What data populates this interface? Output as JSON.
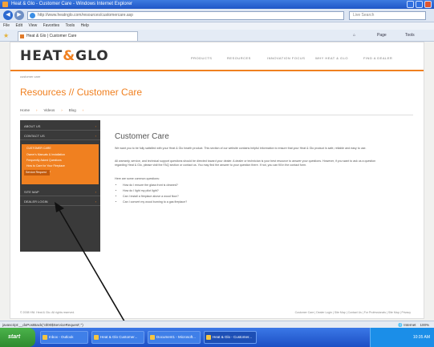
{
  "window": {
    "title": "Heat & Glo - Customer Care - Windows Internet Explorer"
  },
  "browser": {
    "address": "http://www.heatnglo.com/resources/customercare.asp",
    "search_placeholder": "Live Search",
    "menu": [
      "File",
      "Edit",
      "View",
      "Favorites",
      "Tools",
      "Help"
    ],
    "tab_label": "Heat & Glo | Customer Care",
    "commands": [
      "Page",
      "Tools"
    ]
  },
  "site": {
    "logo_left": "HEAT",
    "logo_flame": "&",
    "logo_right": "GLO",
    "topnav": [
      "PRODUCTS",
      "RESOURCES",
      "INNOVATION FOCUS",
      "WHY HEAT & GLO",
      "FIND A DEALER"
    ],
    "breadcrumb": "customer care",
    "page_heading": "Resources // Customer Care",
    "subnav": [
      "Home",
      "Videos",
      "Blog"
    ],
    "sidebar": {
      "items": [
        "ABOUT US",
        "CONTACT US"
      ],
      "active_item": "CUSTOMER CARE",
      "sub_items": [
        "Owner's Manuals & Installation",
        "Frequently Asked Questions",
        "How to Care for Your Fireplace",
        "Replacement Parts",
        "Service Request"
      ],
      "bottom_items": [
        "SITE MAP",
        "DEALER LOGIN"
      ]
    },
    "content": {
      "title": "Customer Care",
      "para1": "We want you to be fully satisfied with your Heat & Glo hearth product. This section of our website contains helpful information to ensure that your Heat & Glo product is safe, reliable and easy to use.",
      "para2": "All warranty, service, and technical support questions should be directed toward your dealer. A dealer or technician is your best resource to answer your questions. However, if you want to ask us a question regarding Heat & Glo, please visit the FAQ section or contact us. You may find the answer to your question there. If not, you can fill in the contact form.",
      "para3": "Here are some common questions:",
      "bullets": [
        "How do I ensure the glass front is cleaned?",
        "How do I light my pilot light?",
        "Can I install a fireplace above a wood floor?",
        "Can I convert my wood burning to a gas fireplace?"
      ]
    },
    "footer": "© 2008 HNI. Heat & Glo. All rights reserved.",
    "footer_links": [
      "Customer Care",
      "Dealer Login",
      "Site Map",
      "Contact Us",
      "For Professionals",
      "Site Map",
      "Privacy"
    ]
  },
  "status": {
    "text": "javascript:__doPostBack('ctl00$ServiceRequest','')",
    "zone": "Internet",
    "zoom": "100%"
  },
  "taskbar": {
    "start_label": "start",
    "tasks": [
      "Inbox - Outlook",
      "Heat & Glo Customer...",
      "Document1 - Microsoft...",
      "Heat & Glo - Customer..."
    ],
    "clock": "10:35 AM"
  }
}
